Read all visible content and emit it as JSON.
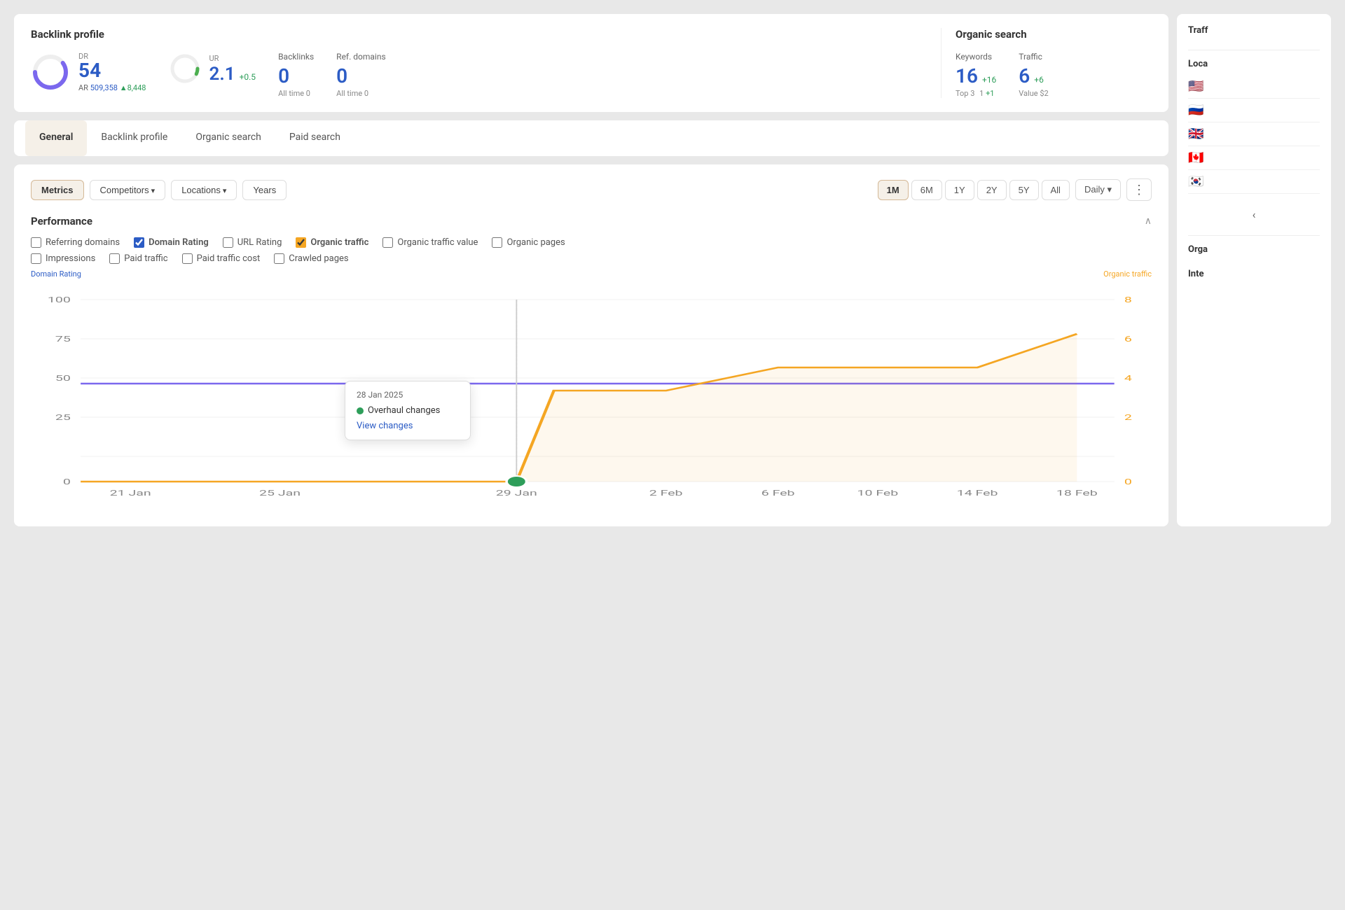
{
  "backlink": {
    "title": "Backlink profile",
    "dr": {
      "label": "DR",
      "value": "54",
      "ar_label": "AR",
      "ar_value": "509,358",
      "ar_change": "▲8,448"
    },
    "ur": {
      "label": "UR",
      "value": "2.1",
      "change": "+0.5"
    },
    "backlinks": {
      "label": "Backlinks",
      "value": "0",
      "sub": "All time  0"
    },
    "ref_domains": {
      "label": "Ref. domains",
      "value": "0",
      "sub": "All time  0"
    }
  },
  "organic": {
    "title": "Organic search",
    "keywords": {
      "label": "Keywords",
      "value": "16",
      "change": "+16",
      "sub1": "Top 3",
      "sub1_val": "1",
      "sub1_change": "+1"
    },
    "traffic": {
      "label": "Traffic",
      "value": "6",
      "change": "+6",
      "sub": "Value  $2"
    }
  },
  "tabs": [
    {
      "id": "general",
      "label": "General",
      "active": true
    },
    {
      "id": "backlink-profile",
      "label": "Backlink profile",
      "active": false
    },
    {
      "id": "organic-search",
      "label": "Organic search",
      "active": false
    },
    {
      "id": "paid-search",
      "label": "Paid search",
      "active": false
    }
  ],
  "toolbar": {
    "metrics_label": "Metrics",
    "competitors_label": "Competitors",
    "locations_label": "Locations",
    "years_label": "Years",
    "time_buttons": [
      "1M",
      "6M",
      "1Y",
      "2Y",
      "5Y",
      "All"
    ],
    "active_time": "1M",
    "daily_label": "Daily",
    "more_icon": "⋮"
  },
  "performance": {
    "title": "Performance",
    "checkboxes": [
      {
        "id": "referring-domains",
        "label": "Referring domains",
        "checked": false,
        "bold": false,
        "color": "none"
      },
      {
        "id": "domain-rating",
        "label": "Domain Rating",
        "checked": true,
        "bold": true,
        "color": "blue"
      },
      {
        "id": "url-rating",
        "label": "URL Rating",
        "checked": false,
        "bold": false,
        "color": "none"
      },
      {
        "id": "organic-traffic",
        "label": "Organic traffic",
        "checked": true,
        "bold": true,
        "color": "orange"
      },
      {
        "id": "organic-traffic-value",
        "label": "Organic traffic value",
        "checked": false,
        "bold": false,
        "color": "none"
      },
      {
        "id": "organic-pages",
        "label": "Organic pages",
        "checked": false,
        "bold": false,
        "color": "none"
      },
      {
        "id": "impressions",
        "label": "Impressions",
        "checked": false,
        "bold": false,
        "color": "none"
      },
      {
        "id": "paid-traffic",
        "label": "Paid traffic",
        "checked": false,
        "bold": false,
        "color": "none"
      },
      {
        "id": "paid-traffic-cost",
        "label": "Paid traffic cost",
        "checked": false,
        "bold": false,
        "color": "none"
      },
      {
        "id": "crawled-pages",
        "label": "Crawled pages",
        "checked": false,
        "bold": false,
        "color": "none"
      }
    ],
    "axis_left_label": "Domain Rating",
    "axis_right_label": "Organic traffic",
    "y_left": [
      "100",
      "75",
      "50",
      "25",
      "0"
    ],
    "y_right": [
      "8",
      "6",
      "4",
      "2",
      "0"
    ],
    "x_labels": [
      "21 Jan",
      "25 Jan",
      "29 Jan",
      "2 Feb",
      "6 Feb",
      "10 Feb",
      "14 Feb",
      "18 Feb"
    ]
  },
  "tooltip": {
    "date": "28 Jan 2025",
    "event": "Overhaul changes",
    "link": "View changes"
  },
  "sidebar": {
    "traffic_title": "Traff",
    "location_title": "Loca",
    "locations": [
      {
        "flag": "🇺🇸",
        "value": ""
      },
      {
        "flag": "🇷🇺",
        "value": ""
      },
      {
        "flag": "🇬🇧",
        "value": ""
      },
      {
        "flag": "🇨🇦",
        "value": ""
      },
      {
        "flag": "🇰🇷",
        "value": ""
      }
    ],
    "organic_label": "Orga",
    "inter_label": "Inte",
    "back_arrow": "‹"
  }
}
